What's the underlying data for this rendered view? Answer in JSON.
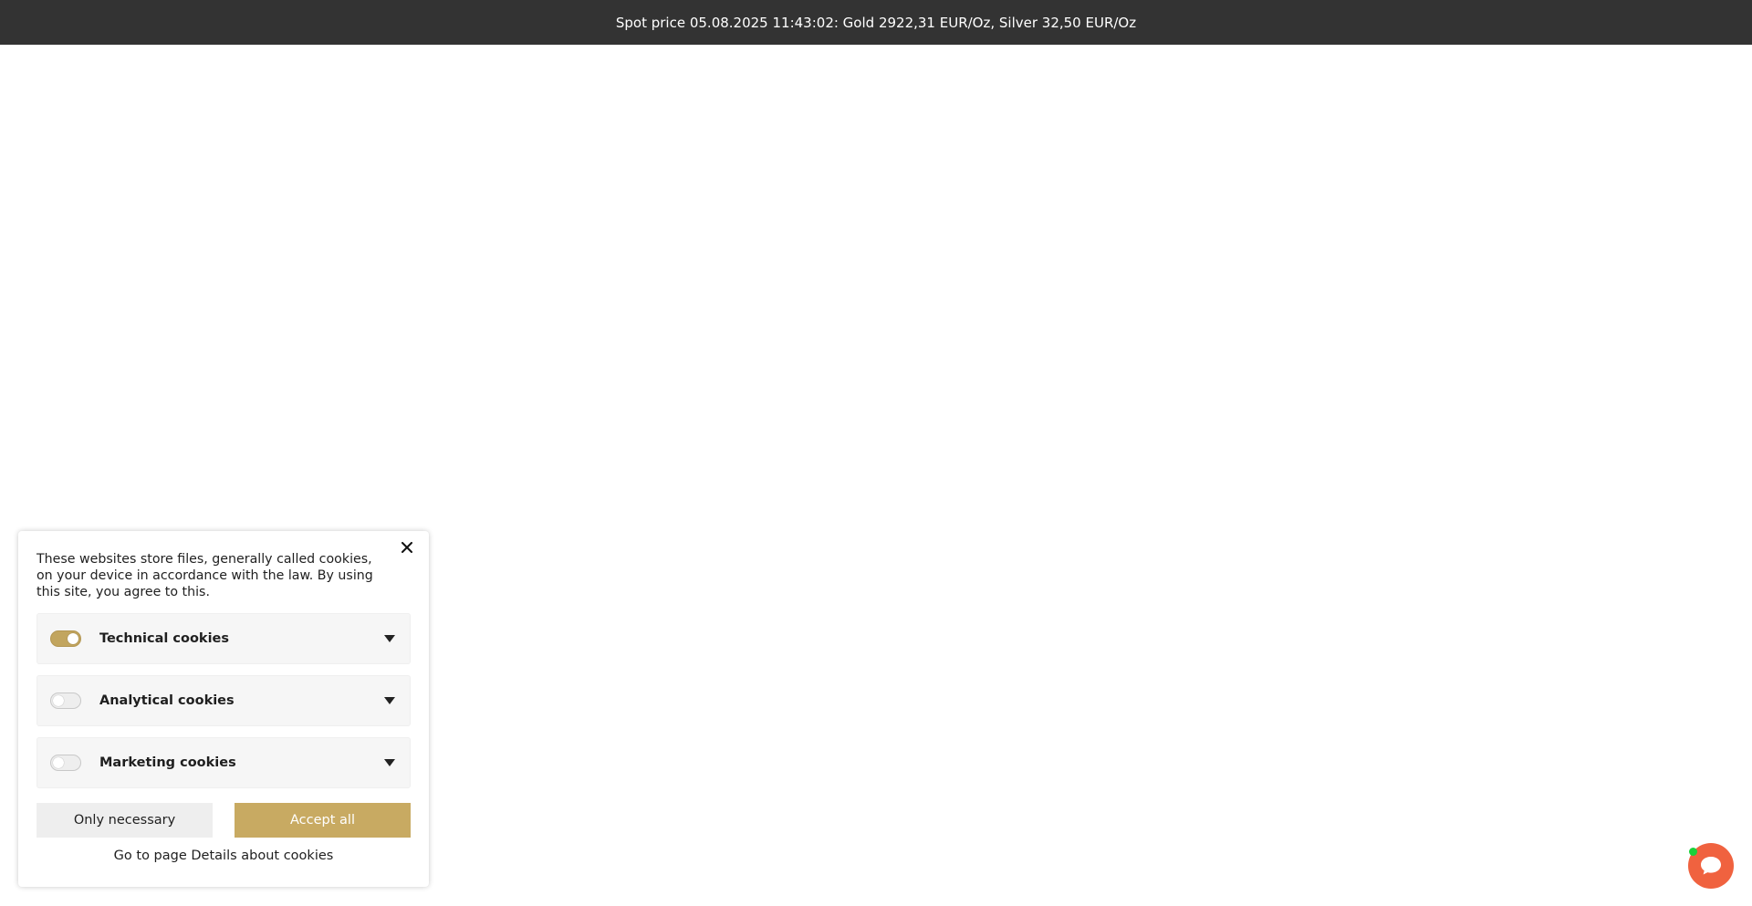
{
  "topbar": {
    "spot_price": "Spot price 05.08.2025 11:43:02: Gold 2922,31 EUR/Oz, Silver 32,50 EUR/Oz"
  },
  "cookie_panel": {
    "intro": "These websites store files, generally called cookies, on your device in accordance with the law. By using this site, you agree to this.",
    "groups": [
      {
        "label": "Technical cookies",
        "enabled": true
      },
      {
        "label": "Analytical cookies",
        "enabled": false
      },
      {
        "label": "Marketing cookies",
        "enabled": false
      }
    ],
    "only_necessary_label": "Only necessary",
    "accept_all_label": "Accept all",
    "details_link": "Go to page Details about cookies",
    "close_icon": "close-icon"
  },
  "chat": {
    "icon": "chat-bubble-icon",
    "status": "online"
  },
  "colors": {
    "topbar_bg": "#333333",
    "accent_gold": "#c8aa62",
    "chat_orange": "#f0623f",
    "online_green": "#19d23a"
  }
}
